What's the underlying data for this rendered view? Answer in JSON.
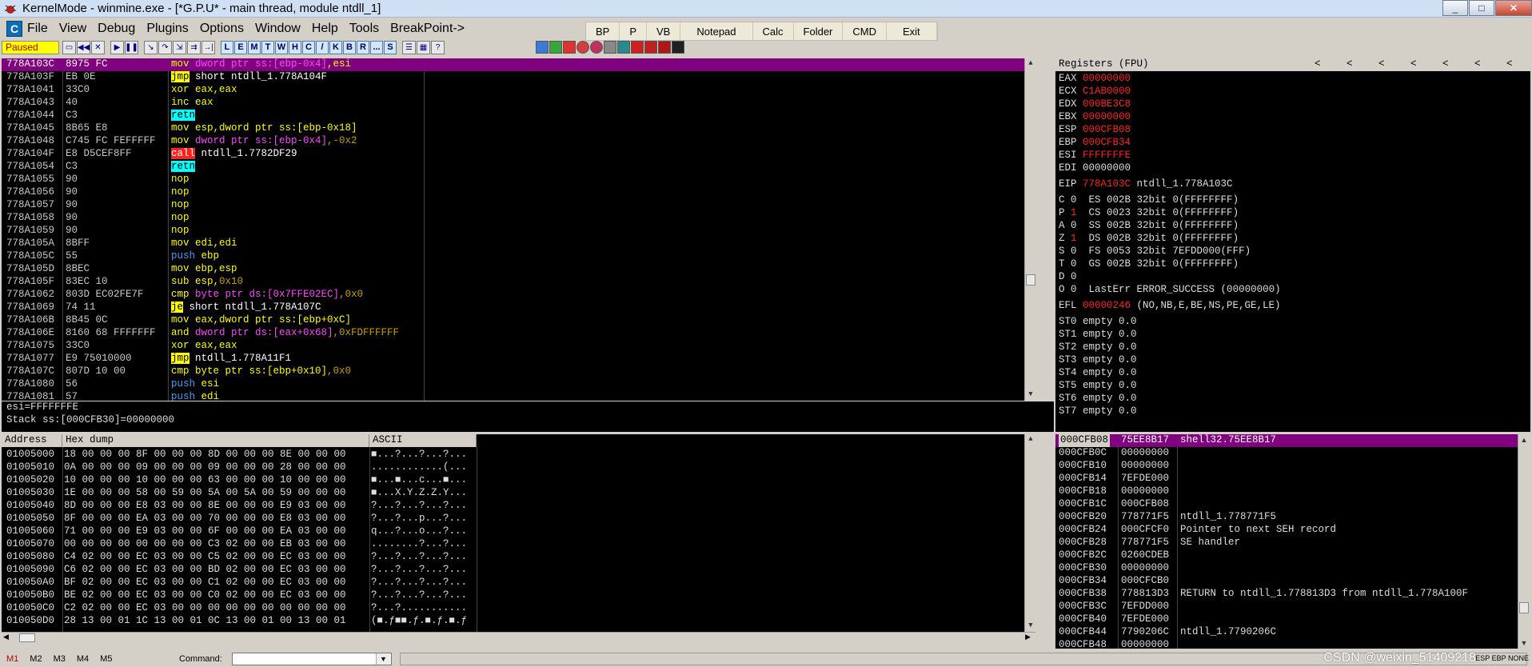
{
  "window": {
    "title": "KernelMode - winmine.exe - [*G.P.U* - main thread, module ntdll_1]",
    "controls": [
      "_",
      "□",
      "✕"
    ]
  },
  "menu": [
    "File",
    "View",
    "Debug",
    "Plugins",
    "Options",
    "Window",
    "Help",
    "Tools",
    "BreakPoint->"
  ],
  "top_buttons": [
    "BP",
    "P",
    "VB",
    "Notepad",
    "Calc",
    "Folder",
    "CMD",
    "Exit"
  ],
  "toolbar": {
    "status": "Paused",
    "letters": [
      "L",
      "E",
      "M",
      "T",
      "W",
      "H",
      "C",
      "/",
      "K",
      "B",
      "R",
      "...",
      "S"
    ]
  },
  "disasm": [
    {
      "addr": "778A103C",
      "hex": "8975 FC",
      "asm": [
        [
          "mov ",
          "k-yel"
        ],
        [
          "dword ptr ss:[ebp-0x4]",
          "k-mag"
        ],
        [
          ",esi",
          "k-yel"
        ]
      ],
      "sel": true
    },
    {
      "addr": "778A103F",
      "hex": "EB 0E",
      "asm": [
        [
          "jmp",
          "hl-yel"
        ],
        [
          " short ntdll_1.778A104F",
          "k-white"
        ]
      ]
    },
    {
      "addr": "778A1041",
      "hex": "33C0",
      "asm": [
        [
          "xor eax,eax",
          "k-yel"
        ]
      ]
    },
    {
      "addr": "778A1043",
      "hex": "40",
      "asm": [
        [
          "inc eax",
          "k-yel"
        ]
      ]
    },
    {
      "addr": "778A1044",
      "hex": "C3",
      "asm": [
        [
          "retn",
          "hl-cyan"
        ]
      ]
    },
    {
      "addr": "778A1045",
      "hex": "8B65 E8",
      "asm": [
        [
          "mov esp,",
          "k-yel"
        ],
        [
          "dword ptr ss:[ebp-0x18]",
          "k-yel"
        ]
      ]
    },
    {
      "addr": "778A1048",
      "hex": "C745 FC FEFFFFF",
      "asm": [
        [
          "mov ",
          "k-yel"
        ],
        [
          "dword ptr ss:[ebp-0x4]",
          "k-mag"
        ],
        [
          ",-0x2",
          "k-olive"
        ]
      ]
    },
    {
      "addr": "778A104F",
      "hex": "E8 D5CEF8FF",
      "asm": [
        [
          "call",
          "hl-red"
        ],
        [
          " ntdll_1.7782DF29",
          "k-white"
        ]
      ]
    },
    {
      "addr": "778A1054",
      "hex": "C3",
      "asm": [
        [
          "retn",
          "hl-cyan"
        ]
      ]
    },
    {
      "addr": "778A1055",
      "hex": "90",
      "asm": [
        [
          "nop",
          "k-yel"
        ]
      ]
    },
    {
      "addr": "778A1056",
      "hex": "90",
      "asm": [
        [
          "nop",
          "k-yel"
        ]
      ]
    },
    {
      "addr": "778A1057",
      "hex": "90",
      "asm": [
        [
          "nop",
          "k-yel"
        ]
      ]
    },
    {
      "addr": "778A1058",
      "hex": "90",
      "asm": [
        [
          "nop",
          "k-yel"
        ]
      ]
    },
    {
      "addr": "778A1059",
      "hex": "90",
      "asm": [
        [
          "nop",
          "k-yel"
        ]
      ]
    },
    {
      "addr": "778A105A",
      "hex": "8BFF",
      "asm": [
        [
          "mov edi,edi",
          "k-yel"
        ]
      ]
    },
    {
      "addr": "778A105C",
      "hex": "55",
      "asm": [
        [
          "push ",
          "k-blue"
        ],
        [
          "ebp",
          "k-yel"
        ]
      ]
    },
    {
      "addr": "778A105D",
      "hex": "8BEC",
      "asm": [
        [
          "mov ebp,esp",
          "k-yel"
        ]
      ]
    },
    {
      "addr": "778A105F",
      "hex": "83EC 10",
      "asm": [
        [
          "sub esp,",
          "k-yel"
        ],
        [
          "0x10",
          "k-olive"
        ]
      ]
    },
    {
      "addr": "778A1062",
      "hex": "803D EC02FE7F",
      "asm": [
        [
          "cmp ",
          "k-yel"
        ],
        [
          "byte ptr ds:[0x7FFE02EC]",
          "k-mag"
        ],
        [
          ",0x0",
          "k-olive"
        ]
      ]
    },
    {
      "addr": "778A1069",
      "hex": "74 11",
      "asm": [
        [
          "je",
          "hl-yel"
        ],
        [
          " short ntdll_1.778A107C",
          "k-white"
        ]
      ]
    },
    {
      "addr": "778A106B",
      "hex": "8B45 0C",
      "asm": [
        [
          "mov eax,",
          "k-yel"
        ],
        [
          "dword ptr ss:[ebp+0xC]",
          "k-yel"
        ]
      ]
    },
    {
      "addr": "778A106E",
      "hex": "8160 68 FFFFFFF",
      "asm": [
        [
          "and ",
          "k-yel"
        ],
        [
          "dword ptr ds:[eax+0x68]",
          "k-mag"
        ],
        [
          ",0xFDFFFFFF",
          "k-olive"
        ]
      ]
    },
    {
      "addr": "778A1075",
      "hex": "33C0",
      "asm": [
        [
          "xor eax,eax",
          "k-yel"
        ]
      ]
    },
    {
      "addr": "778A1077",
      "hex": "E9 75010000",
      "asm": [
        [
          "jmp",
          "hl-yel"
        ],
        [
          " ntdll_1.778A11F1",
          "k-white"
        ]
      ]
    },
    {
      "addr": "778A107C",
      "hex": "807D 10 00",
      "asm": [
        [
          "cmp ",
          "k-yel"
        ],
        [
          "byte ptr ss:[ebp+0x10]",
          "k-yel"
        ],
        [
          ",0x0",
          "k-olive"
        ]
      ]
    },
    {
      "addr": "778A1080",
      "hex": "56",
      "asm": [
        [
          "push ",
          "k-blue"
        ],
        [
          "esi",
          "k-yel"
        ]
      ]
    },
    {
      "addr": "778A1081",
      "hex": "57",
      "asm": [
        [
          "push ",
          "k-blue"
        ],
        [
          "edi",
          "k-yel"
        ]
      ]
    }
  ],
  "info": [
    "esi=FFFFFFFE",
    "Stack ss:[000CFB30]=00000000"
  ],
  "registers": {
    "title": "Registers (FPU)",
    "gp": [
      {
        "name": "EAX",
        "val": "00000000",
        "red": true,
        "note": ""
      },
      {
        "name": "ECX",
        "val": "C1AB0000",
        "red": true,
        "note": ""
      },
      {
        "name": "EDX",
        "val": "000BE3C8",
        "red": true,
        "note": ""
      },
      {
        "name": "EBX",
        "val": "00000000",
        "red": true,
        "note": ""
      },
      {
        "name": "ESP",
        "val": "000CFB08",
        "red": true,
        "note": ""
      },
      {
        "name": "EBP",
        "val": "000CFB34",
        "red": true,
        "note": ""
      },
      {
        "name": "ESI",
        "val": "FFFFFFFE",
        "red": true,
        "note": ""
      },
      {
        "name": "EDI",
        "val": "00000000",
        "red": false,
        "note": ""
      }
    ],
    "eip": {
      "name": "EIP",
      "val": "778A103C",
      "note": "ntdll_1.778A103C"
    },
    "flags": [
      {
        "f": "C 0",
        "seg": "ES 002B 32bit 0(FFFFFFFF)"
      },
      {
        "f": "P 1",
        "seg": "CS 0023 32bit 0(FFFFFFFF)"
      },
      {
        "f": "A 0",
        "seg": "SS 002B 32bit 0(FFFFFFFF)"
      },
      {
        "f": "Z 1",
        "seg": "DS 002B 32bit 0(FFFFFFFF)"
      },
      {
        "f": "S 0",
        "seg": "FS 0053 32bit 7EFDD000(FFF)"
      },
      {
        "f": "T 0",
        "seg": "GS 002B 32bit 0(FFFFFFFF)"
      },
      {
        "f": "D 0",
        "seg": ""
      },
      {
        "f": "O 0",
        "seg": "LastErr ERROR_SUCCESS (00000000)"
      }
    ],
    "efl": {
      "name": "EFL",
      "val": "00000246",
      "note": "(NO,NB,E,BE,NS,PE,GE,LE)"
    },
    "fpu": [
      "ST0 empty 0.0",
      "ST1 empty 0.0",
      "ST2 empty 0.0",
      "ST3 empty 0.0",
      "ST4 empty 0.0",
      "ST5 empty 0.0",
      "ST6 empty 0.0",
      "ST7 empty 0.0"
    ]
  },
  "dump": {
    "headers": [
      "Address",
      "Hex dump",
      "ASCII"
    ],
    "rows": [
      [
        "01005000",
        "18 00 00 00 8F 00 00 00 8D 00 00 00 8E 00 00 00",
        "■...?...?...?..."
      ],
      [
        "01005010",
        "0A 00 00 00 09 00 00 00 09 00 00 00 28 00 00 00",
        "............(..."
      ],
      [
        "01005020",
        "10 00 00 00 10 00 00 00 63 00 00 00 10 00 00 00",
        "■...■...c...■..."
      ],
      [
        "01005030",
        "1E 00 00 00 58 00 59 00 5A 00 5A 00 59 00 00 00",
        "■...X.Y.Z.Z.Y..."
      ],
      [
        "01005040",
        "8D 00 00 00 E8 03 00 00 8E 00 00 00 E9 03 00 00",
        "?...?...?...?..."
      ],
      [
        "01005050",
        "8F 00 00 00 EA 03 00 00 70 00 00 00 E8 03 00 00",
        "?...?...p...?..."
      ],
      [
        "01005060",
        "71 00 00 00 E9 03 00 00 6F 00 00 00 EA 03 00 00",
        "q...?...o...?..."
      ],
      [
        "01005070",
        "00 00 00 00 00 00 00 00 C3 02 00 00 EB 03 00 00",
        "........?...?..."
      ],
      [
        "01005080",
        "C4 02 00 00 EC 03 00 00 C5 02 00 00 EC 03 00 00",
        "?...?...?...?..."
      ],
      [
        "01005090",
        "C6 02 00 00 EC 03 00 00 BD 02 00 00 EC 03 00 00",
        "?...?...?...?..."
      ],
      [
        "010050A0",
        "BF 02 00 00 EC 03 00 00 C1 02 00 00 EC 03 00 00",
        "?...?...?...?..."
      ],
      [
        "010050B0",
        "BE 02 00 00 EC 03 00 00 C0 02 00 00 EC 03 00 00",
        "?...?...?...?..."
      ],
      [
        "010050C0",
        "C2 02 00 00 EC 03 00 00 00 00 00 00 00 00 00 00",
        "?...?..........."
      ],
      [
        "010050D0",
        "28 13 00 01 1C 13 00 01 0C 13 00 01 00 13 00 01",
        "(■.ƒ■■.ƒ.■.ƒ.■.ƒ"
      ]
    ]
  },
  "stack": [
    {
      "addr": "000CFB08",
      "val": "75EE8B17",
      "comment": "shell32.75EE8B17",
      "sel": true
    },
    {
      "addr": "000CFB0C",
      "val": "00000000",
      "comment": ""
    },
    {
      "addr": "000CFB10",
      "val": "00000000",
      "comment": ""
    },
    {
      "addr": "000CFB14",
      "val": "7EFDE000",
      "comment": ""
    },
    {
      "addr": "000CFB18",
      "val": "00000000",
      "comment": ""
    },
    {
      "addr": "000CFB1C",
      "val": "000CFB08",
      "comment": ""
    },
    {
      "addr": "000CFB20",
      "val": "778771F5",
      "comment": "ntdll_1.778771F5"
    },
    {
      "addr": "000CFB24",
      "val": "000CFCF0",
      "comment": "Pointer to next SEH record"
    },
    {
      "addr": "000CFB28",
      "val": "778771F5",
      "comment": "SE handler"
    },
    {
      "addr": "000CFB2C",
      "val": "0260CDEB",
      "comment": ""
    },
    {
      "addr": "000CFB30",
      "val": "00000000",
      "comment": ""
    },
    {
      "addr": "000CFB34",
      "val": "000CFCB0",
      "comment": ""
    },
    {
      "addr": "000CFB38",
      "val": "778813D3",
      "comment": "RETURN to ntdll_1.778813D3 from ntdll_1.778A100F"
    },
    {
      "addr": "000CFB3C",
      "val": "7EFDD000",
      "comment": ""
    },
    {
      "addr": "000CFB40",
      "val": "7EFDE000",
      "comment": ""
    },
    {
      "addr": "000CFB44",
      "val": "7790206C",
      "comment": "ntdll_1.7790206C"
    },
    {
      "addr": "000CFB48",
      "val": "00000000",
      "comment": ""
    }
  ],
  "bottom": {
    "tabs": [
      "M1",
      "M2",
      "M3",
      "M4",
      "M5"
    ],
    "command_label": "Command:",
    "command_value": "",
    "watermark": "CSDN @weixin_51409218",
    "mini_status": "ESP  EBP  NONE"
  }
}
